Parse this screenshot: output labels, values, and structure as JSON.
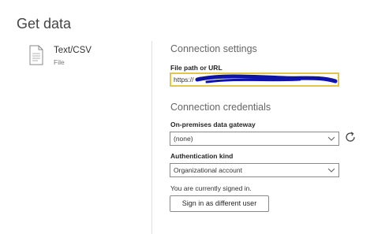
{
  "page": {
    "title": "Get data"
  },
  "source": {
    "name": "Text/CSV",
    "type": "File",
    "icon": "document-icon"
  },
  "settings": {
    "heading": "Connection settings",
    "file_path_label": "File path or URL",
    "file_path_value": "https://"
  },
  "credentials": {
    "heading": "Connection credentials",
    "gateway_label": "On-premises data gateway",
    "gateway_value": "(none)",
    "auth_label": "Authentication kind",
    "auth_value": "Organizational account",
    "signed_in_text": "You are currently signed in.",
    "sign_in_button": "Sign in as different user"
  },
  "colors": {
    "focus_border": "#e2c64a",
    "redaction": "#0f14a8"
  }
}
